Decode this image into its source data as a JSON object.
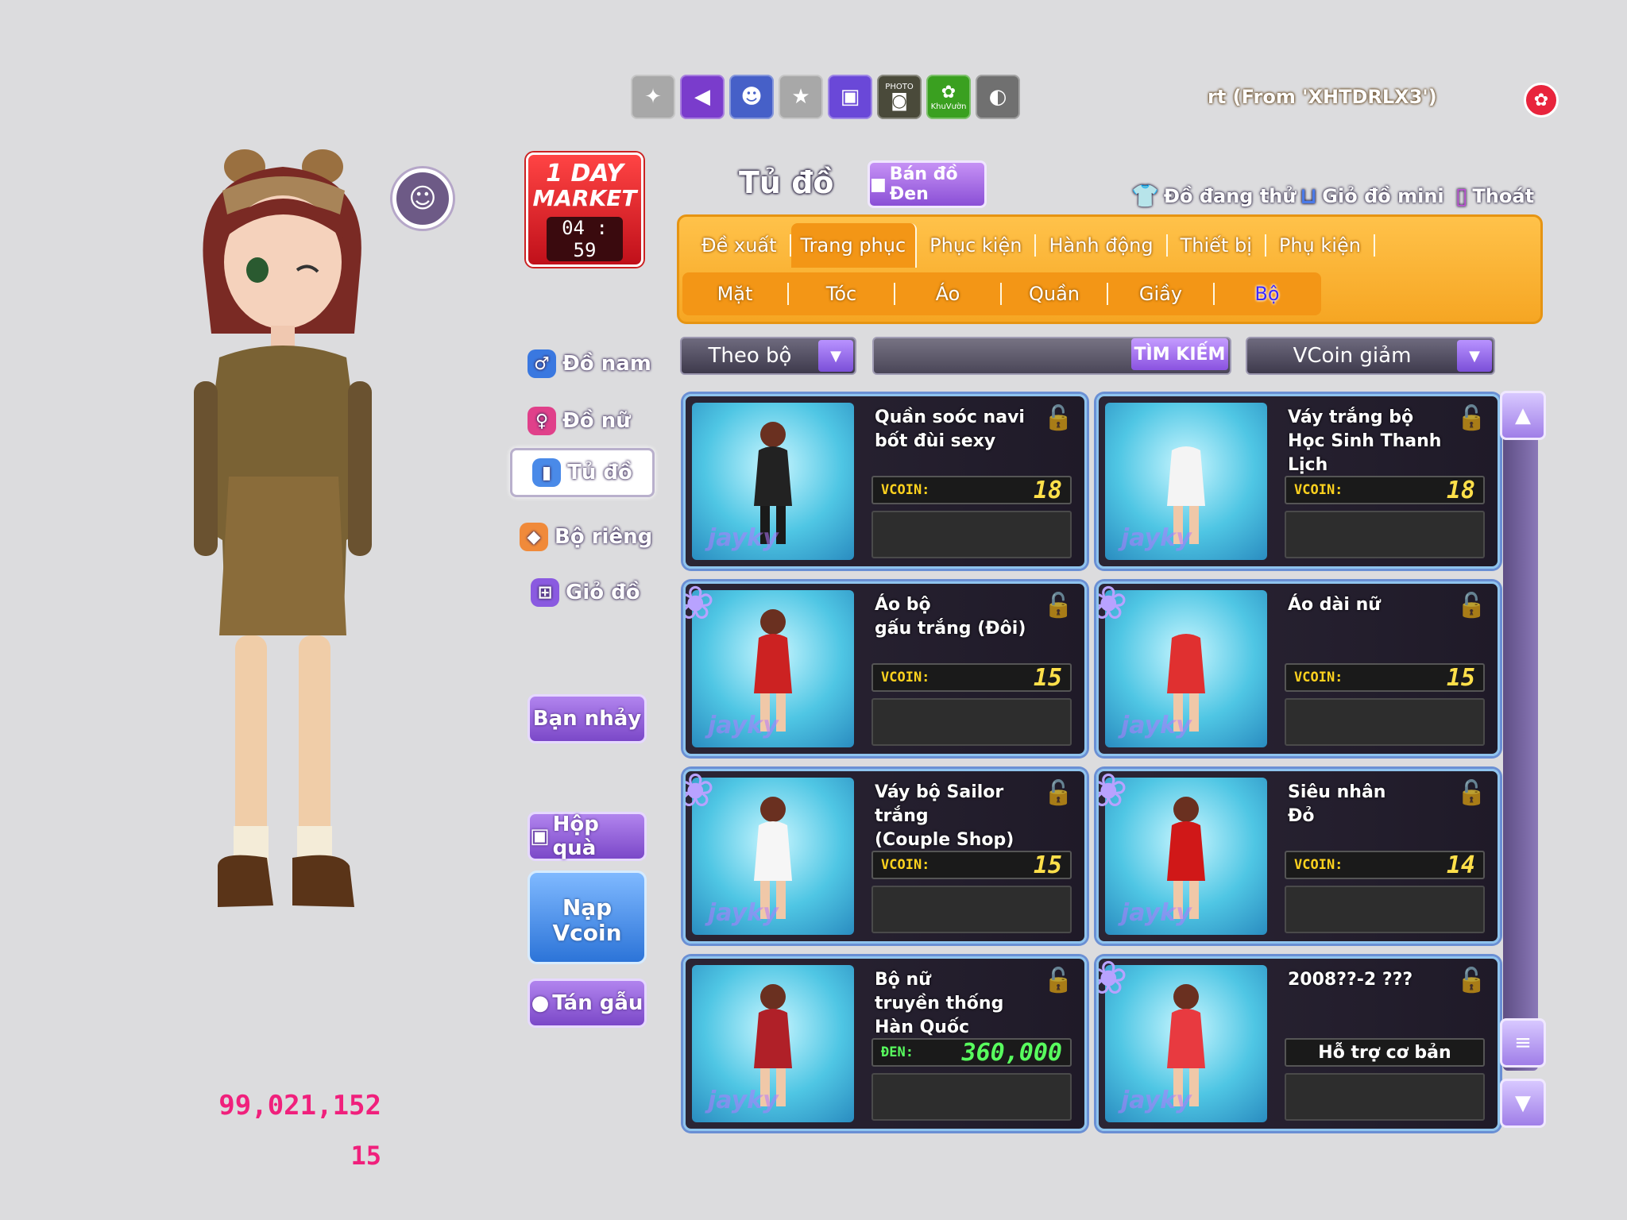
{
  "top_icons": [
    {
      "name": "blank-slot-icon",
      "glyph": "✦",
      "color": "#a8a8a8"
    },
    {
      "name": "megaphone-icon",
      "glyph": "📢",
      "color": "#7a3ccc"
    },
    {
      "name": "friends-icon",
      "glyph": "☻",
      "color": "#4660c8"
    },
    {
      "name": "star-slot-icon",
      "glyph": "★",
      "color": "#a8a8a8"
    },
    {
      "name": "tv-icon",
      "glyph": "▣",
      "color": "#6a48d8"
    },
    {
      "name": "photo-icon",
      "glyph": "◙",
      "color": "#4a4a3a"
    },
    {
      "name": "garden-icon",
      "glyph": "✿",
      "color": "#3aa020"
    },
    {
      "name": "pet-icon",
      "glyph": "◐",
      "color": "#707070"
    }
  ],
  "garden_label": "KhuVườn",
  "photo_label": "PHOTO",
  "notice": "rt (From 'XHTDRLX3')",
  "market": {
    "line1": "1 DAY",
    "line2": "MARKET",
    "timer": "04 : 59"
  },
  "left_menu": {
    "men": "Đồ nam",
    "women": "Đồ nữ",
    "wardrobe": "Tủ đồ",
    "private_sets": "Bộ riêng",
    "basket": "Giỏ đồ",
    "partner": "Bạn nhảy",
    "gift_box": "Hộp quà",
    "topup": [
      "Nạp",
      "Vcoin"
    ],
    "chat": "Tán gẫu"
  },
  "header": {
    "title": "Tủ đồ",
    "sell_den": "Bán đồ Đen",
    "trying": "Đồ đang thử",
    "mini_basket": "Giỏ đồ mini",
    "exit": "Thoát"
  },
  "tabs": [
    "Đề xuất",
    "Trang phục",
    "Phục kiện",
    "Hành động",
    "Thiết bị",
    "Phụ kiện"
  ],
  "subtabs": [
    "Mặt",
    "Tóc",
    "Áo",
    "Quần",
    "Giầy",
    "Bộ"
  ],
  "filters": {
    "category": "Theo bộ",
    "search_button": "TÌM KIẾM",
    "sort": "VCoin giảm"
  },
  "items": [
    {
      "name": "Quần soóc navi\nbốt đùi sexy",
      "currency": "VCOIN:",
      "price": "18"
    },
    {
      "name": "Váy trắng bộ\nHọc Sinh Thanh Lịch\n(Đôi)",
      "currency": "VCOIN:",
      "price": "18"
    },
    {
      "name": "Áo bộ\ngấu trắng (Đôi)",
      "currency": "VCOIN:",
      "price": "15"
    },
    {
      "name": "Áo dài nữ",
      "currency": "VCOIN:",
      "price": "15"
    },
    {
      "name": "Váy bộ Sailor\ntrắng\n(Couple Shop)",
      "currency": "VCOIN:",
      "price": "15"
    },
    {
      "name": "Siêu nhân\nĐỏ",
      "currency": "VCOIN:",
      "price": "14"
    },
    {
      "name": "Bộ nữ\ntruyền thống\nHàn Quốc",
      "currency": "ĐEN:",
      "price": "360,000"
    },
    {
      "name": "2008??-2 ???",
      "support": "Hỗ trợ cơ bản"
    }
  ],
  "watermark": "jayky",
  "balance": "99,021,152",
  "level": "15",
  "colors": {
    "accent_orange": "#f6a623",
    "accent_purple": "#8a52e0",
    "money_pink": "#f0207c"
  }
}
